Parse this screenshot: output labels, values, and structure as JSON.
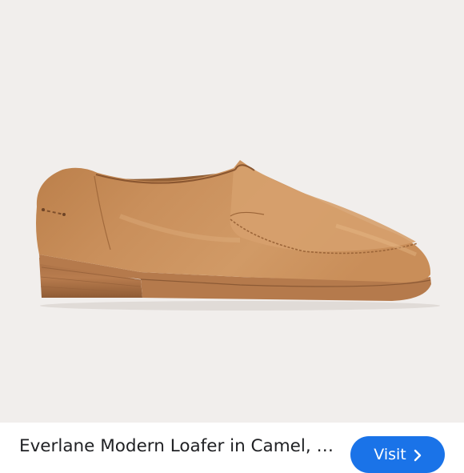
{
  "product": {
    "title": "Everlane Modern Loafer in Camel, ",
    "title_continued": "…",
    "image_alt": "Camel leather loafer"
  },
  "actions": {
    "visit_label": "Visit",
    "visit_icon": "chevron-right-icon"
  },
  "colors": {
    "image_background": "#f1eeec",
    "accent": "#1a73e8",
    "leather": "#c58b55"
  }
}
